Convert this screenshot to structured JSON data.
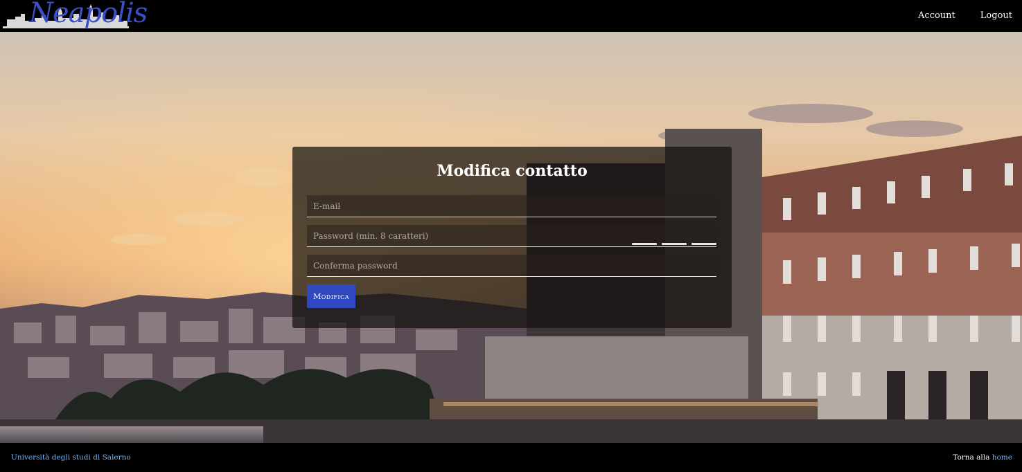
{
  "header": {
    "logo_text": "Neapolis",
    "nav": [
      {
        "label": "Account"
      },
      {
        "label": "Logout"
      }
    ]
  },
  "form": {
    "title": "Modifica contatto",
    "email_placeholder": "E-mail",
    "password_placeholder": "Password (min. 8 caratteri)",
    "confirm_placeholder": "Conferma password",
    "submit_label": "Modifica"
  },
  "footer": {
    "university_link": "Università degli studi di Salerno",
    "back_text": "Torna alla",
    "home_link": "home"
  },
  "colors": {
    "accent": "#3049c3",
    "link": "#6fb6ff"
  }
}
